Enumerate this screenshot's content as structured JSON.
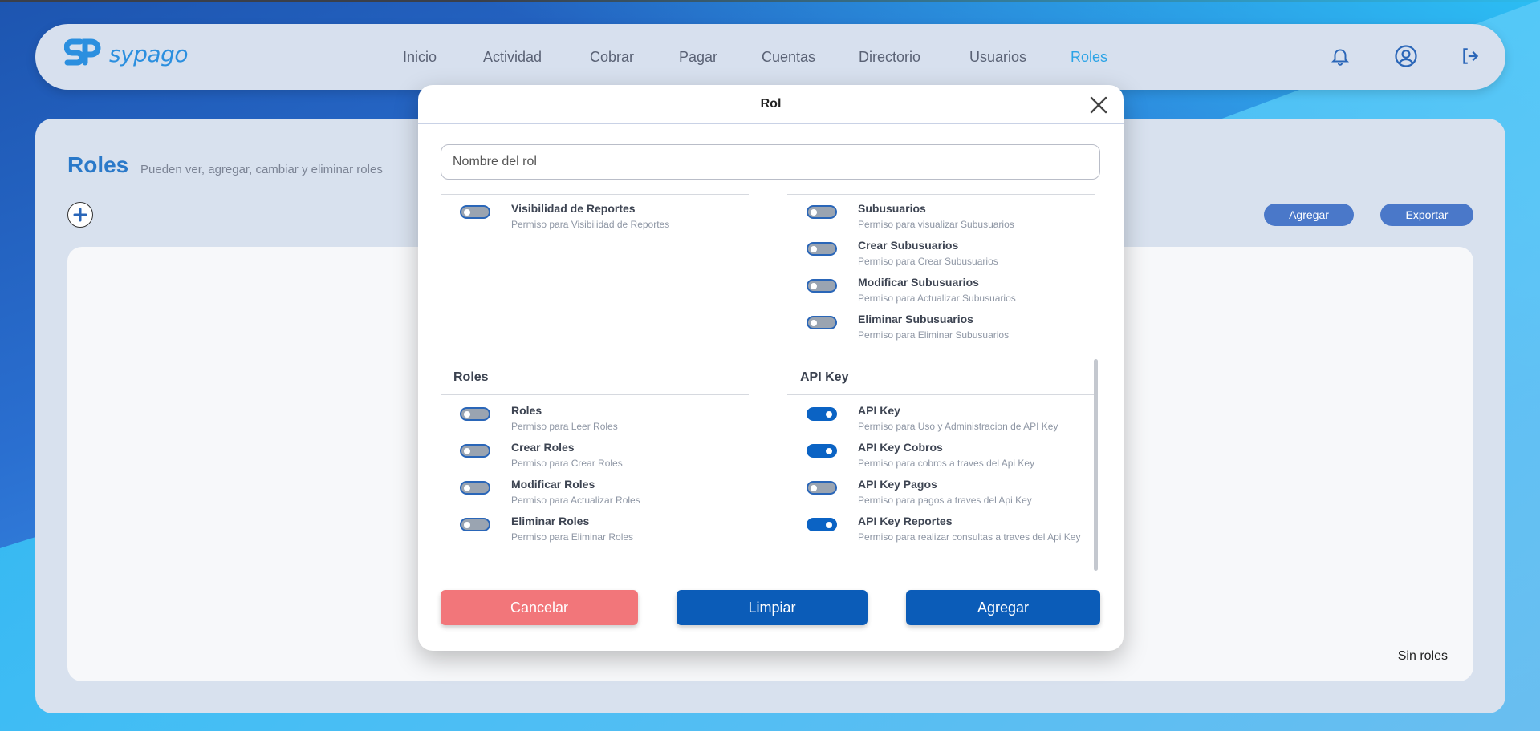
{
  "brand": {
    "name": "sypago"
  },
  "nav": {
    "items": [
      {
        "label": "Inicio"
      },
      {
        "label": "Actividad"
      },
      {
        "label": "Cobrar"
      },
      {
        "label": "Pagar"
      },
      {
        "label": "Cuentas"
      },
      {
        "label": "Directorio"
      },
      {
        "label": "Usuarios"
      },
      {
        "label": "Roles",
        "active": true
      }
    ],
    "icons": [
      "bell-icon",
      "user-circle-icon",
      "logout-icon"
    ]
  },
  "page": {
    "title": "Roles",
    "subtitle": "Pueden ver, agregar, cambiar y eliminar roles",
    "add_label": "Agregar",
    "export_label": "Exportar",
    "empty_text": "Sin roles"
  },
  "modal": {
    "title": "Rol",
    "name_placeholder": "Nombre del rol",
    "left_top": [
      {
        "label": "Visibilidad de Reportes",
        "desc": "Permiso para Visibilidad de Reportes",
        "on": false
      }
    ],
    "right_top": [
      {
        "label": "Subusuarios",
        "desc": "Permiso para visualizar Subusuarios",
        "on": false
      },
      {
        "label": "Crear Subusuarios",
        "desc": "Permiso para Crear Subusuarios",
        "on": false
      },
      {
        "label": "Modificar Subusuarios",
        "desc": "Permiso para Actualizar Subusuarios",
        "on": false
      },
      {
        "label": "Eliminar Subusuarios",
        "desc": "Permiso para Eliminar Subusuarios",
        "on": false
      }
    ],
    "sections": [
      {
        "title": "Roles",
        "perms": [
          {
            "label": "Roles",
            "desc": "Permiso para Leer Roles",
            "on": false
          },
          {
            "label": "Crear Roles",
            "desc": "Permiso para Crear Roles",
            "on": false
          },
          {
            "label": "Modificar Roles",
            "desc": "Permiso para Actualizar Roles",
            "on": false
          },
          {
            "label": "Eliminar Roles",
            "desc": "Permiso para Eliminar Roles",
            "on": false
          }
        ]
      },
      {
        "title": "API Key",
        "perms": [
          {
            "label": "API Key",
            "desc": "Permiso para Uso y Administracion de API Key",
            "on": true
          },
          {
            "label": "API Key Cobros",
            "desc": "Permiso para cobros a traves del Api Key",
            "on": true
          },
          {
            "label": "API Key Pagos",
            "desc": "Permiso para pagos a traves del Api Key",
            "on": false
          },
          {
            "label": "API Key Reportes",
            "desc": "Permiso para realizar consultas a traves del Api Key",
            "on": true
          }
        ]
      }
    ],
    "buttons": {
      "cancel": "Cancelar",
      "clear": "Limpiar",
      "submit": "Agregar"
    }
  },
  "colors": {
    "accent": "#2aa3e6",
    "primary": "#0b5cb8",
    "danger": "#f2767a"
  }
}
